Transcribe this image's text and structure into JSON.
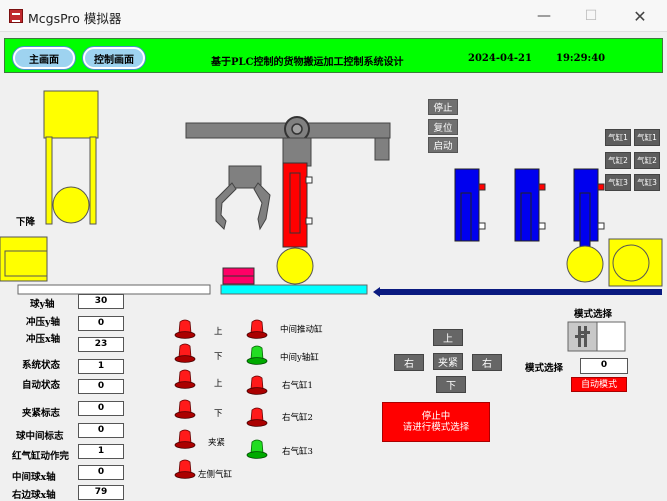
{
  "window": {
    "title": "McgsPro 模拟器",
    "min_glyph": "—",
    "max_glyph": "☐",
    "close_glyph": "✕"
  },
  "header": {
    "nav_main": "主画面",
    "nav_control": "控制画面",
    "system_title": "基于PLC控制的货物搬运加工控制系统设计",
    "date": "2024-04-21",
    "time": "19:29:40"
  },
  "scene": {
    "press_down_label": "下降"
  },
  "control_buttons": {
    "stop": "停止",
    "reset": "复位",
    "start": "启动"
  },
  "cylinder_buttons": [
    "气缸1",
    "气缸1",
    "气缸2",
    "气缸2",
    "气缸3",
    "气缸3"
  ],
  "readouts": [
    {
      "label": "球y轴",
      "value": "30"
    },
    {
      "label": "冲压y轴",
      "value": "0"
    },
    {
      "label": "冲压x轴",
      "value": "23"
    },
    {
      "label": "系统状态",
      "value": "1"
    },
    {
      "label": "自动状态",
      "value": "0"
    },
    {
      "label": "夹紧标志",
      "value": "0"
    },
    {
      "label": "球中间标志",
      "value": "0"
    },
    {
      "label": "红气缸动作完",
      "value": "1"
    },
    {
      "label": "中间球x轴",
      "value": "0"
    },
    {
      "label": "右边球x轴",
      "value": "79"
    }
  ],
  "indicators_left": [
    {
      "label": "上",
      "color": "red"
    },
    {
      "label": "下",
      "color": "red"
    },
    {
      "label": "上",
      "color": "red"
    },
    {
      "label": "下",
      "color": "red"
    },
    {
      "label": "夹紧",
      "color": "red"
    },
    {
      "label": "左侧气缸",
      "color": "red"
    }
  ],
  "indicators_right": [
    {
      "label": "中间推动缸",
      "color": "red"
    },
    {
      "label": "中间y轴缸",
      "color": "green"
    },
    {
      "label": "右气缸1",
      "color": "red"
    },
    {
      "label": "右气缸2",
      "color": "red"
    },
    {
      "label": "右气缸3",
      "color": "green"
    }
  ],
  "manual": {
    "up": "上",
    "left": "右",
    "clamp": "夹紧",
    "right": "右",
    "down": "下"
  },
  "mode": {
    "title": "模式选择",
    "value_label": "模式选择",
    "value": "0",
    "auto_badge": "自动模式"
  },
  "status_message": {
    "line1": "停止中",
    "line2": "请进行模式选择"
  },
  "colors": {
    "header_bg": "#00ff00",
    "lamp_red": "#ff1a1a",
    "lamp_green": "#22dd22",
    "cylinder_blue": "#0000ee"
  }
}
